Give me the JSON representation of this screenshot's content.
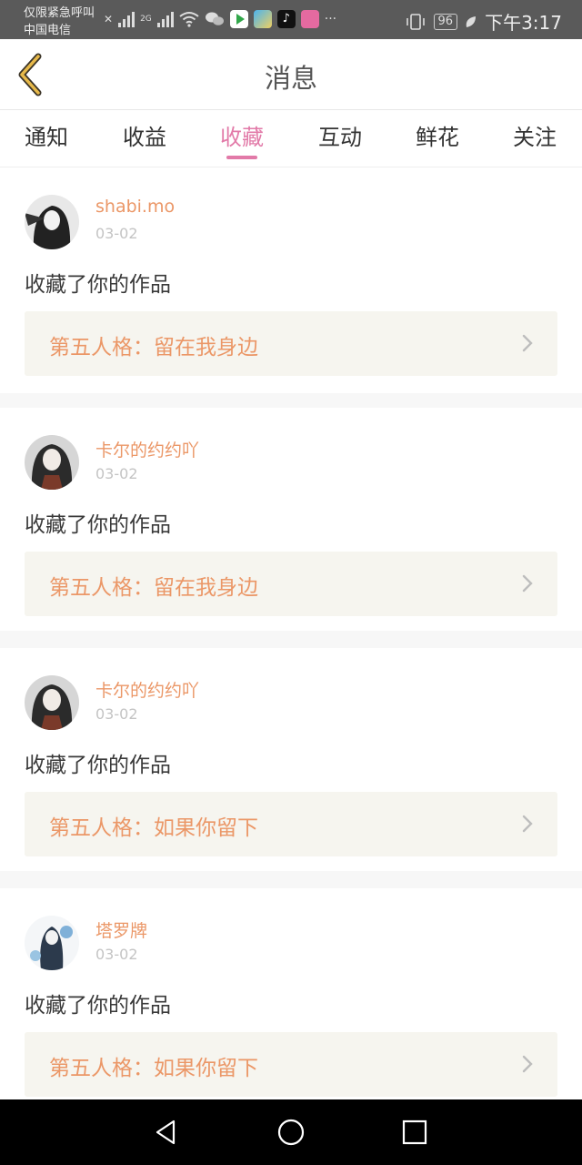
{
  "status_bar": {
    "carrier_line1": "仅限紧急呼叫",
    "carrier_line2": "中国电信",
    "network_label": "2G",
    "more_label": "···",
    "battery_level": "96",
    "time": "下午3:17"
  },
  "header": {
    "title": "消息",
    "back_icon": "chevron-left-icon"
  },
  "tabs": [
    {
      "label": "通知",
      "active": false
    },
    {
      "label": "收益",
      "active": false
    },
    {
      "label": "收藏",
      "active": true
    },
    {
      "label": "互动",
      "active": false
    },
    {
      "label": "鲜花",
      "active": false
    },
    {
      "label": "关注",
      "active": false
    }
  ],
  "messages": [
    {
      "username": "shabi.mo",
      "date": "03-02",
      "action": "收藏了你的作品",
      "work": "第五人格：留在我身边"
    },
    {
      "username": "卡尔的约约吖",
      "date": "03-02",
      "action": "收藏了你的作品",
      "work": "第五人格：留在我身边"
    },
    {
      "username": "卡尔的约约吖",
      "date": "03-02",
      "action": "收藏了你的作品",
      "work": "第五人格：如果你留下"
    },
    {
      "username": "塔罗牌",
      "date": "03-02",
      "action": "收藏了你的作品",
      "work": "第五人格：如果你留下"
    }
  ],
  "nav_bar": {
    "back": "triangle-back-icon",
    "home": "circle-home-icon",
    "recents": "square-recents-icon"
  },
  "colors": {
    "accent": "#e27aa8",
    "username": "#eb9767",
    "back_arrow": "#d9a23a",
    "work_bg": "#f6f5ef"
  }
}
